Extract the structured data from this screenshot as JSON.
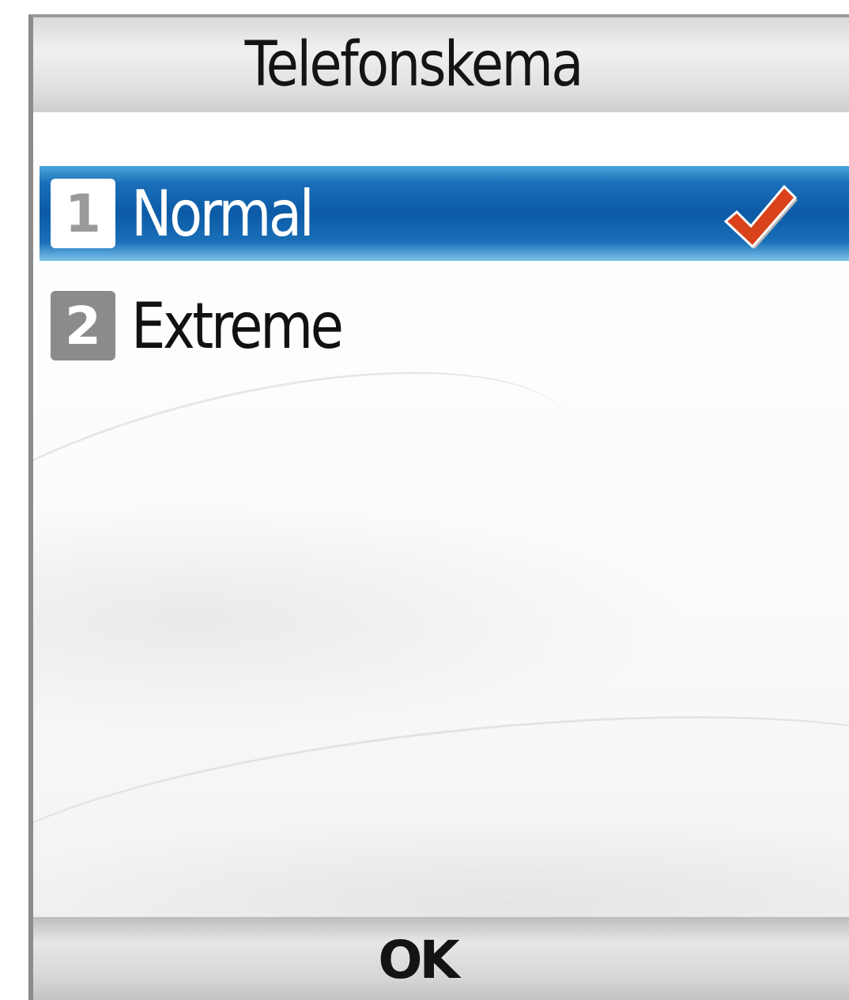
{
  "header": {
    "title": "Telefonskema"
  },
  "list": {
    "items": [
      {
        "number": "1",
        "label": "Normal",
        "selected": true,
        "checked": true
      },
      {
        "number": "2",
        "label": "Extreme",
        "selected": false,
        "checked": false
      }
    ],
    "check_icon": "checkmark-icon"
  },
  "softkeys": {
    "center": "OK"
  },
  "colors": {
    "selection": "#0c5aa6",
    "checkmark": "#d9421a"
  }
}
